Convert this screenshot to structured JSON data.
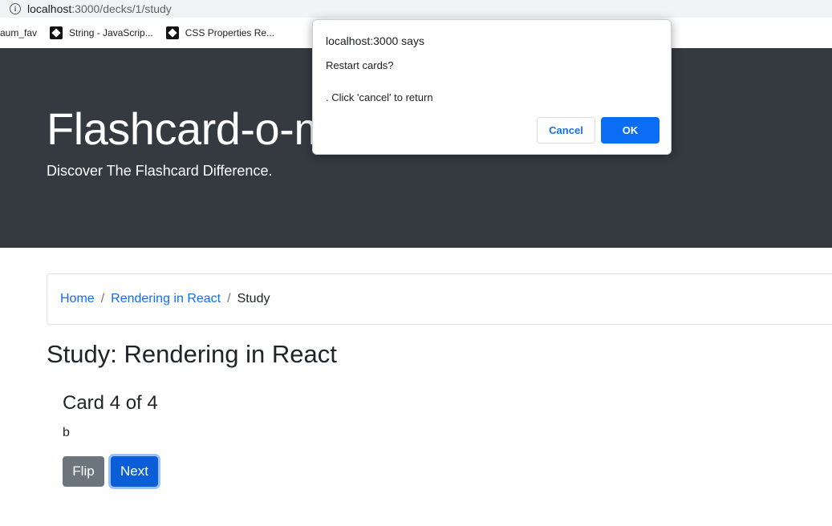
{
  "browser": {
    "url_host": "localhost",
    "url_path": ":3000/decks/1/study",
    "bookmarks": [
      {
        "label": "aum_fav"
      },
      {
        "label": "String - JavaScrip..."
      },
      {
        "label": "CSS Properties Re..."
      }
    ]
  },
  "hero": {
    "title": "Flashcard-o-matic",
    "subtitle": "Discover The Flashcard Difference."
  },
  "breadcrumb": {
    "home": "Home",
    "separator": "/",
    "deck": "Rendering in React",
    "current": "Study"
  },
  "study": {
    "title": "Study: Rendering in React",
    "card_counter": "Card 4 of 4",
    "card_text": "b",
    "flip_label": "Flip",
    "next_label": "Next"
  },
  "dialog": {
    "title": "localhost:3000 says",
    "line1": "Restart cards?",
    "line2": ". Click 'cancel' to return",
    "cancel_label": "Cancel",
    "ok_label": "OK"
  },
  "colors": {
    "hero_bg": "#343a40",
    "link": "#0d6efd",
    "primary": "#0b5ed7",
    "secondary": "#6c757d"
  }
}
